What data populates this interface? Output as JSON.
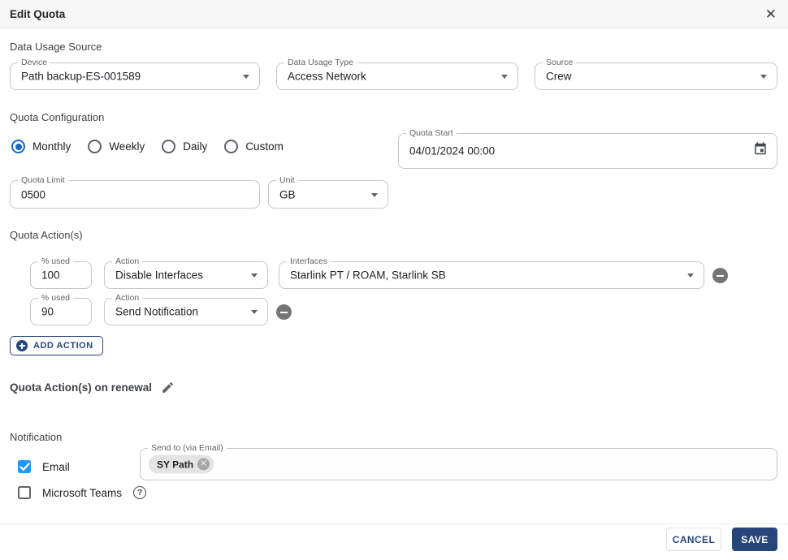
{
  "header": {
    "title": "Edit Quota",
    "close_glyph": "✕"
  },
  "data_usage_source": {
    "title": "Data Usage Source",
    "device": {
      "label": "Device",
      "value": "Path backup-ES-001589"
    },
    "data_usage_type": {
      "label": "Data Usage Type",
      "value": "Access Network"
    },
    "source": {
      "label": "Source",
      "value": "Crew"
    }
  },
  "quota_configuration": {
    "title": "Quota Configuration",
    "period_options": [
      {
        "label": "Monthly",
        "selected": true
      },
      {
        "label": "Weekly",
        "selected": false
      },
      {
        "label": "Daily",
        "selected": false
      },
      {
        "label": "Custom",
        "selected": false
      }
    ],
    "quota_start": {
      "label": "Quota Start",
      "value": "04/01/2024 00:00"
    },
    "quota_limit": {
      "label": "Quota Limit",
      "value": "0500"
    },
    "unit": {
      "label": "Unit",
      "value": "GB"
    }
  },
  "quota_actions": {
    "title": "Quota Action(s)",
    "rows": [
      {
        "percent_label": "% used",
        "percent": "100",
        "action_label": "Action",
        "action": "Disable Interfaces",
        "interfaces_label": "Interfaces",
        "interfaces": "Starlink PT / ROAM, Starlink SB"
      },
      {
        "percent_label": "% used",
        "percent": "90",
        "action_label": "Action",
        "action": "Send Notification"
      }
    ],
    "add_action_label": "ADD ACTION",
    "renewal_label": "Quota Action(s) on renewal"
  },
  "notification": {
    "title": "Notification",
    "email": {
      "label": "Email",
      "checked": true
    },
    "teams": {
      "label": "Microsoft Teams",
      "checked": false,
      "help_glyph": "?"
    },
    "send_to": {
      "label": "Send to (via Email)",
      "chips": [
        {
          "text": "SY Path",
          "remove_glyph": "✕"
        }
      ]
    }
  },
  "footer": {
    "cancel_label": "CANCEL",
    "save_label": "SAVE"
  },
  "colors": {
    "primary_navy": "#27477a",
    "radio_blue": "#1669c9",
    "checkbox_blue": "#2196f3",
    "header_bg": "#f7f7f7",
    "field_border": "#c4c7cb"
  }
}
